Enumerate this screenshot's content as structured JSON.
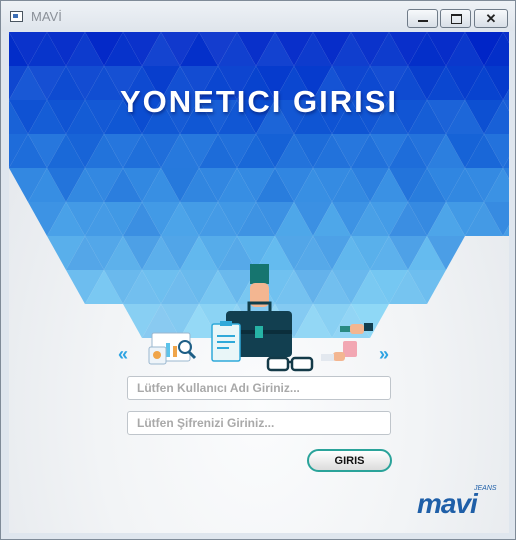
{
  "window": {
    "title": "MAVİ",
    "close_glyph": "✕"
  },
  "colors": {
    "banner_blue": "#0d47d8",
    "accent_blue": "#2da3e2",
    "button_border": "#2aa39a",
    "logo_blue": "#1f5fa8"
  },
  "banner": {
    "heading": "YONETICI GIRISI"
  },
  "nav": {
    "left_arrow": "«",
    "right_arrow": "»"
  },
  "login": {
    "username_placeholder": "Lütfen Kullanıcı Adı Giriniz...",
    "password_placeholder": "Lütfen Şifrenizi Giriniz...",
    "submit_label": "GIRIS"
  },
  "logo": {
    "word": "mavi",
    "tag": "JEANS"
  }
}
